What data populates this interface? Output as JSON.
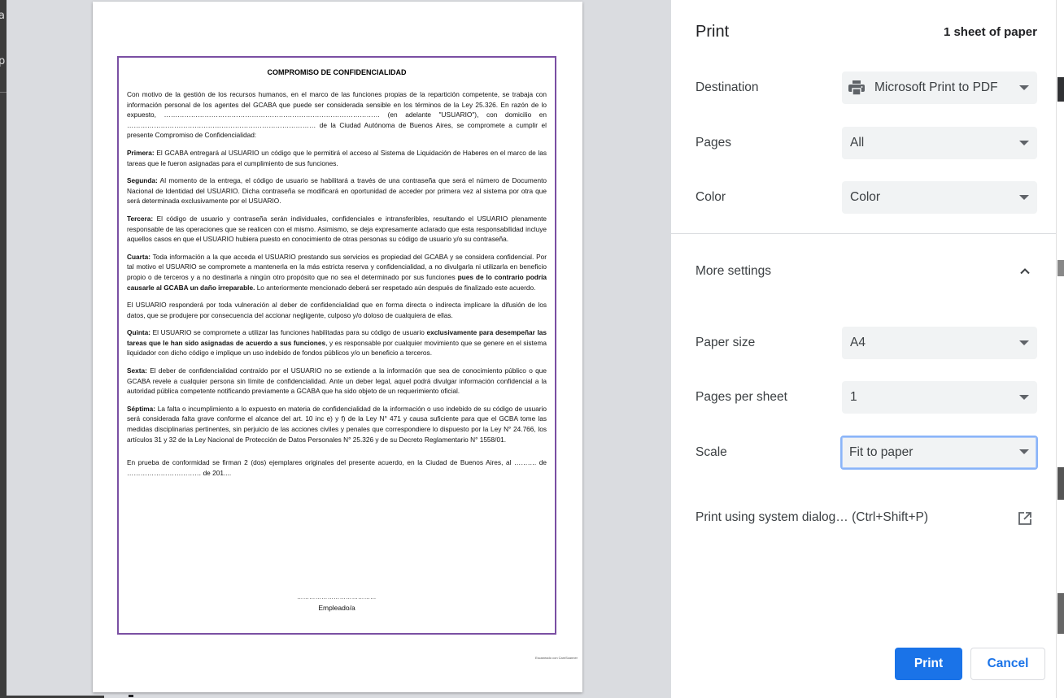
{
  "background": {
    "left_glyphs": [
      "a",
      "p"
    ]
  },
  "preview": {
    "doc_title": "COMPROMISO DE CONFIDENCIALIDAD",
    "paragraphs": [
      {
        "lead": "",
        "text": "Con motivo de la gestión de los recursos humanos, en el marco de las funciones propias de la repartición competente, se trabaja con información personal de los agentes del GCABA que puede ser considerada sensible en los términos de la Ley 25.326. En razón de lo expuesto, …………………………………………………………………………………… (en adelante \"USUARIO\"), con domicilio en ………………………………………………………………………… de la Ciudad Autónoma de Buenos Aires, se compromete a cumplir el presente Compromiso de Confidencialidad:"
      },
      {
        "lead": "Primera:",
        "text": " El GCABA entregará al USUARIO un código que le permitirá el acceso al Sistema de Liquidación de Haberes en el marco de las tareas que le fueron asignadas para el cumplimiento de sus funciones."
      },
      {
        "lead": "Segunda:",
        "text": " Al momento de la entrega, el código de usuario se habilitará a través de una contraseña que será el número de Documento Nacional de Identidad del USUARIO. Dicha contraseña se modificará en oportunidad de acceder por primera vez al sistema por otra que será determinada exclusivamente por el USUARIO."
      },
      {
        "lead": "Tercera:",
        "text": " El código de usuario y contraseña serán individuales, confidenciales e intransferibles, resultando el USUARIO plenamente responsable de las operaciones que se realicen con el mismo. Asimismo, se deja expresamente aclarado que esta responsabilidad incluye aquellos casos en que el USUARIO hubiera puesto en conocimiento de otras personas su código de usuario y/o su contraseña."
      },
      {
        "lead": "Cuarta:",
        "text": " Toda información a la que acceda el USUARIO prestando sus servicios es propiedad del GCABA y se considera confidencial. Por tal motivo el USUARIO se compromete a mantenerla en la más estricta reserva y confidencialidad, a no divulgarla ni utilizarla en beneficio propio o de terceros y a no destinarla a ningún otro propósito que no sea el determinado por sus funciones ",
        "bold_mid": "pues de lo contrario podría causarle al GCABA un daño irreparable.",
        "tail": " Lo anteriormente mencionado deberá ser respetado aún después de finalizado este acuerdo."
      },
      {
        "lead": "",
        "text": "El USUARIO responderá por toda vulneración al deber de confidencialidad que en forma directa o indirecta implicare la difusión de los datos, que se produjere por consecuencia del accionar negligente, culposo y/o doloso de cualquiera de ellas."
      },
      {
        "lead": "Quinta:",
        "text": " El USUARIO se compromete a utilizar las funciones habilitadas para su código de usuario ",
        "bold_mid": "exclusivamente para desempeñar las tareas que le han sido asignadas de acuerdo a sus funciones",
        "tail": ", y es responsable por cualquier movimiento que se genere en el sistema liquidador con dicho código e implique un uso indebido de fondos públicos y/o un beneficio a terceros."
      },
      {
        "lead": "Sexta:",
        "text": " El deber de confidencialidad contraído por el USUARIO no se extiende a la información que sea de conocimiento público o que GCABA revele a cualquier persona sin límite de confidencialidad. Ante un deber legal, aquel podrá divulgar información confidencial a la autoridad pública competente notificando previamente a GCABA que ha sido objeto de un requerimiento oficial."
      },
      {
        "lead": "Séptima:",
        "text": " La falta o incumplimiento a lo expuesto en materia de confidencialidad de la información o uso indebido de su código de usuario será considerada falta grave conforme el alcance del art. 10 inc e) y f) de la Ley N° 471 y causa suficiente para que el GCBA tome las medidas disciplinarias pertinentes, sin perjuicio de las acciones civiles y penales que correspondiere lo dispuesto por la Ley N° 24.766, los artículos 31 y 32 de la Ley Nacional de Protección de Datos Personales N° 25.326 y de su Decreto Reglamentario N° 1558/01."
      },
      {
        "lead": "",
        "text": "En prueba de conformidad se firman 2 (dos) ejemplares originales del presente acuerdo, en la Ciudad de Buenos Aires, al ………. de …………………………… de 201...."
      }
    ],
    "signature_dots": "…………………………………",
    "signature_label": "Empleado/a",
    "scanner_note": "Escaneado con CamScanner"
  },
  "panel": {
    "title": "Print",
    "sheet_count": "1 sheet of paper",
    "destination": {
      "label": "Destination",
      "value": "Microsoft Print to PDF",
      "icon": "printer-icon"
    },
    "pages": {
      "label": "Pages",
      "value": "All"
    },
    "color": {
      "label": "Color",
      "value": "Color"
    },
    "more_settings": {
      "label": "More settings",
      "icon": "chevron-up-icon",
      "expanded": true
    },
    "paper_size": {
      "label": "Paper size",
      "value": "A4"
    },
    "pages_per_sheet": {
      "label": "Pages per sheet",
      "value": "1"
    },
    "scale": {
      "label": "Scale",
      "value": "Fit to paper"
    },
    "system_dialog": {
      "label": "Print using system dialog… (Ctrl+Shift+P)",
      "icon": "open-external-icon"
    },
    "print_button": "Print",
    "cancel_button": "Cancel"
  },
  "colors": {
    "accent": "#1a73e8",
    "preview_bg": "#dadce0",
    "frame_border": "#7a4fa3",
    "select_bg": "#f1f3f4"
  }
}
